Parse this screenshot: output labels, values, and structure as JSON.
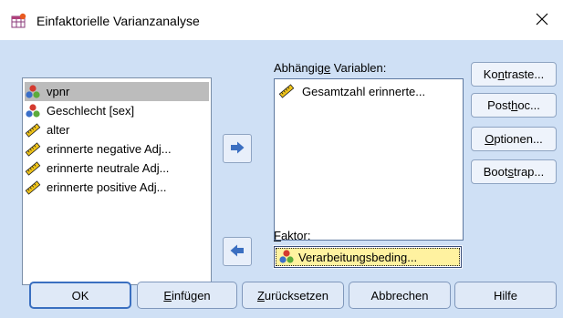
{
  "window": {
    "title": "Einfaktorielle Varianzanalyse",
    "title_icon": "anova-dialog-icon",
    "close_glyph": "✕"
  },
  "source_list": {
    "items": [
      {
        "label": "vpnr",
        "icon": "nominal-variable-icon",
        "selected": true
      },
      {
        "label": "Geschlecht [sex]",
        "icon": "nominal-variable-icon",
        "selected": false
      },
      {
        "label": "alter",
        "icon": "scale-variable-icon",
        "selected": false
      },
      {
        "label": "erinnerte negative Adj...",
        "icon": "scale-variable-icon",
        "selected": false
      },
      {
        "label": "erinnerte neutrale Adj...",
        "icon": "scale-variable-icon",
        "selected": false
      },
      {
        "label": "erinnerte positive Adj...",
        "icon": "scale-variable-icon",
        "selected": false
      }
    ]
  },
  "dependent": {
    "label_pre": "Abhängig",
    "label_ul": "e",
    "label_post": " Variablen:",
    "items": [
      {
        "label": "Gesamtzahl erinnerte...",
        "icon": "scale-variable-icon"
      }
    ]
  },
  "factor": {
    "label_ul": "F",
    "label_post": "aktor:",
    "value": "Verarbeitungsbeding...",
    "icon": "nominal-variable-icon"
  },
  "side_buttons": {
    "contrasts": {
      "pre": "Ko",
      "ul": "n",
      "post": "traste..."
    },
    "posthoc": {
      "pre": "Post ",
      "ul": "h",
      "post": "oc..."
    },
    "options": {
      "pre": "",
      "ul": "O",
      "post": "ptionen..."
    },
    "bootstrap": {
      "pre": "Boot",
      "ul": "s",
      "post": "trap..."
    }
  },
  "bottom_buttons": {
    "ok": {
      "pre": "OK",
      "ul": "",
      "post": ""
    },
    "paste": {
      "pre": "",
      "ul": "E",
      "post": "infügen"
    },
    "reset": {
      "pre": "",
      "ul": "Z",
      "post": "urücksetzen"
    },
    "cancel": {
      "pre": "Abbrechen",
      "ul": "",
      "post": ""
    },
    "help": {
      "pre": "Hilfe",
      "ul": "",
      "post": ""
    }
  },
  "colors": {
    "client_bg": "#cfe0f5",
    "arrow_fill": "#3b6fc1",
    "selected_bg": "#bcbcbc",
    "factor_bg": "#fff2a0"
  }
}
